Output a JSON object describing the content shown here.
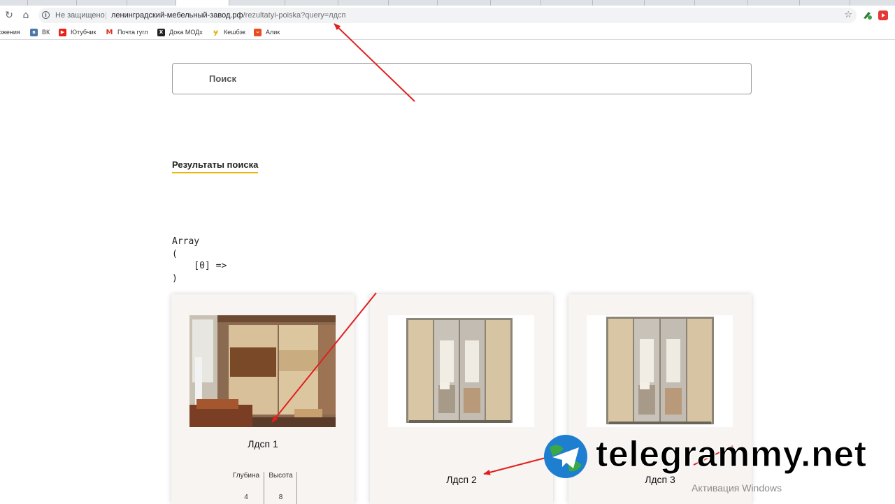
{
  "browser": {
    "address_bar": {
      "security_label": "Не защищено",
      "separator": "|",
      "url_host": "ленинградский-мебельный-завод.рф",
      "url_path": "/rezultatyi-poiska?query=лдсп"
    },
    "bookmarks": [
      {
        "label": "ожения",
        "icon": "apps-icon",
        "color": "#ffffff"
      },
      {
        "label": "ВК",
        "icon": "vk-icon",
        "color": "#4a76a8"
      },
      {
        "label": "Ютубчик",
        "icon": "youtube-icon",
        "color": "#e62117"
      },
      {
        "label": "Почта гугл",
        "icon": "gmail-icon",
        "color": "#d93025"
      },
      {
        "label": "Дока МОДх",
        "icon": "modx-icon",
        "color": "#222222"
      },
      {
        "label": "Кешбэк",
        "icon": "cashback-icon",
        "color": "#f5c400"
      },
      {
        "label": "Алик",
        "icon": "aliexpress-icon",
        "color": "#e84c1f"
      }
    ]
  },
  "page": {
    "search_placeholder": "Поиск",
    "results_title": "Результаты поиска",
    "debug_output": "Array\n(\n    [0] => \n)",
    "products": [
      {
        "name": "Лдсп 1",
        "image": "sliding-wardrobe-bedroom-photo"
      },
      {
        "name": "Лдсп 2",
        "image": "sliding-wardrobe-mirror-photo"
      },
      {
        "name": "Лдсп 3",
        "image": "sliding-wardrobe-mirror-photo"
      }
    ],
    "spec_headers": [
      "Глубина",
      "Высота"
    ],
    "spec_values": [
      "4",
      "8"
    ]
  },
  "overlay": {
    "watermark": "telegrammy.net",
    "activation_title": "Активация Windows",
    "arrow_color": "#e02020"
  }
}
